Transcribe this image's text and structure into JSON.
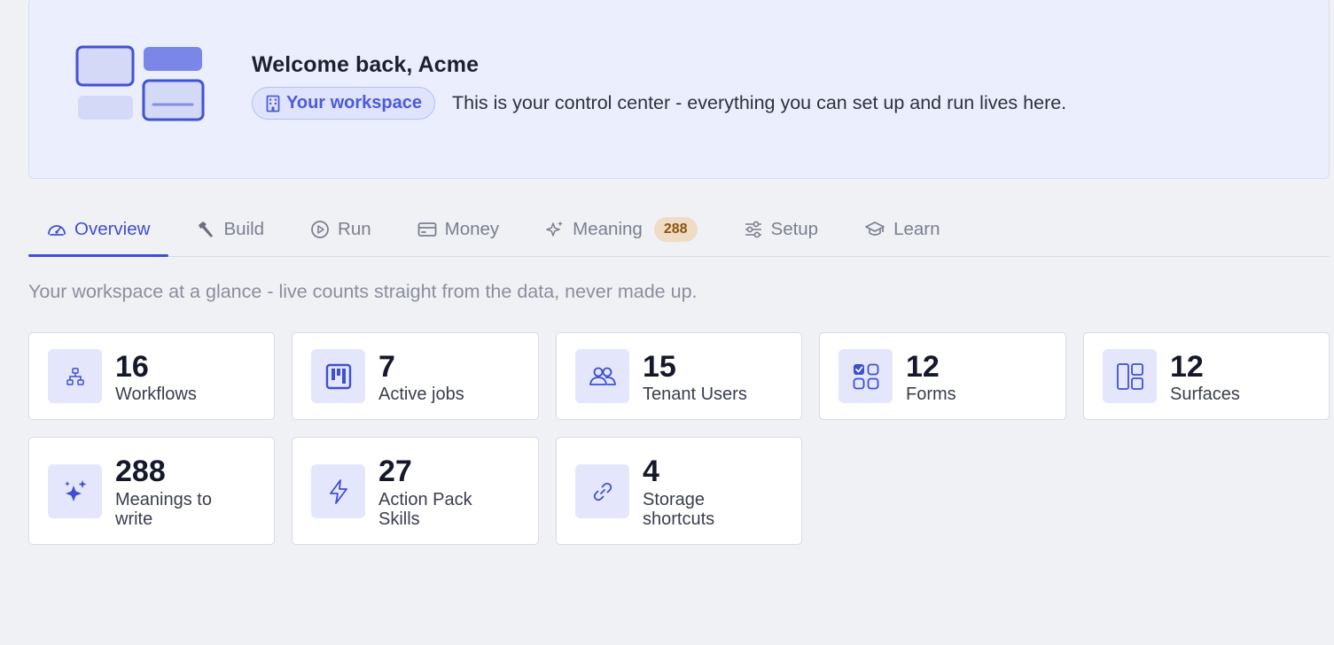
{
  "hero": {
    "title": "Welcome back, Acme",
    "workspace_pill": "Your workspace",
    "description": "This is your control center - everything you can set up and run lives here."
  },
  "tabs": [
    {
      "label": "Overview",
      "icon": "gauge-icon",
      "active": true
    },
    {
      "label": "Build",
      "icon": "hammer-icon"
    },
    {
      "label": "Run",
      "icon": "play-circle-icon"
    },
    {
      "label": "Money",
      "icon": "credit-card-icon"
    },
    {
      "label": "Meaning",
      "icon": "sparkles-icon",
      "badge": "288"
    },
    {
      "label": "Setup",
      "icon": "sliders-icon"
    },
    {
      "label": "Learn",
      "icon": "graduation-cap-icon"
    }
  ],
  "subtitle": "Your workspace at a glance - live counts straight from the data, never made up.",
  "stats": [
    {
      "value": "16",
      "label": "Workflows",
      "icon": "workflow-icon"
    },
    {
      "value": "7",
      "label": "Active jobs",
      "icon": "kanban-icon"
    },
    {
      "value": "15",
      "label": "Tenant Users",
      "icon": "users-icon"
    },
    {
      "value": "12",
      "label": "Forms",
      "icon": "form-grid-icon"
    },
    {
      "value": "12",
      "label": "Surfaces",
      "icon": "layout-icon"
    },
    {
      "value": "288",
      "label": "Meanings to write",
      "icon": "sparkles-icon"
    },
    {
      "value": "27",
      "label": "Action Pack Skills",
      "icon": "lightning-icon"
    },
    {
      "value": "4",
      "label": "Storage shortcuts",
      "icon": "link-icon"
    }
  ],
  "colors": {
    "accent": "#3f4fcf",
    "hero_bg": "#ebeffd",
    "badge_bg": "#efdcc4",
    "badge_text": "#8a5315",
    "icon_tile_bg": "#e4e7fb"
  }
}
